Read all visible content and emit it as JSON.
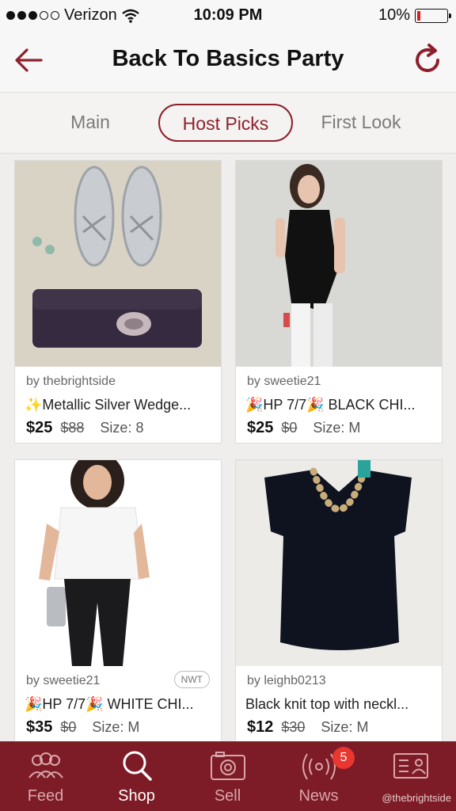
{
  "status_bar": {
    "carrier": "Verizon",
    "time": "10:09 PM",
    "battery": "10%",
    "battery_level": 0.1
  },
  "nav": {
    "title": "Back To Basics Party"
  },
  "tabs": [
    {
      "label": "Main"
    },
    {
      "label": "Host Picks"
    },
    {
      "label": "First Look"
    }
  ],
  "listings": [
    {
      "seller": "by thebrightside",
      "title": "✨Metallic Silver Wedge...",
      "price": "$25",
      "original_price": "$88",
      "size": "Size: 8"
    },
    {
      "seller": "by sweetie21",
      "title": "🎉HP 7/7🎉 BLACK CHI...",
      "price": "$25",
      "original_price": "$0",
      "size": "Size: M"
    },
    {
      "seller": "by sweetie21",
      "title": "🎉HP 7/7🎉 WHITE CHI...",
      "price": "$35",
      "original_price": "$0",
      "size": "Size: M",
      "badge": "NWT"
    },
    {
      "seller": "by leighb0213",
      "title": "Black knit top with neckl...",
      "price": "$12",
      "original_price": "$30",
      "size": "Size: M"
    }
  ],
  "tab_bar": {
    "items": [
      {
        "label": "Feed",
        "icon": "people-icon"
      },
      {
        "label": "Shop",
        "icon": "search-icon"
      },
      {
        "label": "Sell",
        "icon": "camera-icon"
      },
      {
        "label": "News",
        "icon": "broadcast-icon"
      },
      {
        "label": "",
        "icon": "profile-card-icon"
      }
    ],
    "news_badge": "5",
    "watermark": "@thebrightside"
  },
  "colors": {
    "brand": "#8e1f2c",
    "tab_bar": "#7d1c26",
    "badge": "#e8372f"
  }
}
